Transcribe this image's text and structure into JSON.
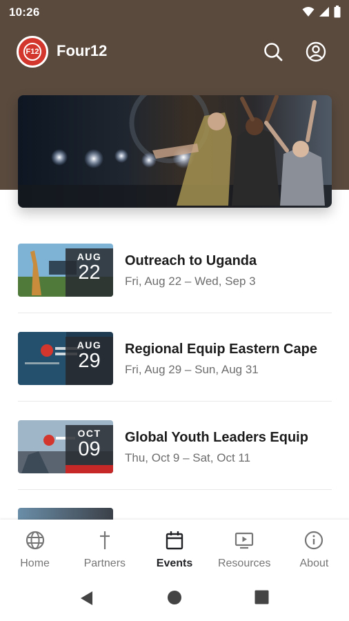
{
  "status_bar": {
    "time": "10:26"
  },
  "app_bar": {
    "title": "Four12",
    "logo_text": "F12"
  },
  "colors": {
    "header_bg": "#5a4a3e",
    "brand_red": "#d3362c",
    "active_tab": "#202124",
    "inactive_tab": "#757575"
  },
  "events": [
    {
      "title": "Outreach to Uganda",
      "dates": "Fri, Aug 22 – Wed, Sep 3",
      "month": "AUG",
      "day": "22"
    },
    {
      "title": "Regional Equip Eastern Cape",
      "dates": "Fri, Aug 29 – Sun, Aug 31",
      "month": "AUG",
      "day": "29"
    },
    {
      "title": "Global Youth Leaders Equip",
      "dates": "Thu, Oct 9 – Sat, Oct 11",
      "month": "OCT",
      "day": "09"
    }
  ],
  "bottom_nav": [
    {
      "label": "Home",
      "icon": "globe-icon",
      "active": false
    },
    {
      "label": "Partners",
      "icon": "cross-icon",
      "active": false
    },
    {
      "label": "Events",
      "icon": "calendar-icon",
      "active": true
    },
    {
      "label": "Resources",
      "icon": "video-icon",
      "active": false
    },
    {
      "label": "About",
      "icon": "info-icon",
      "active": false
    }
  ]
}
